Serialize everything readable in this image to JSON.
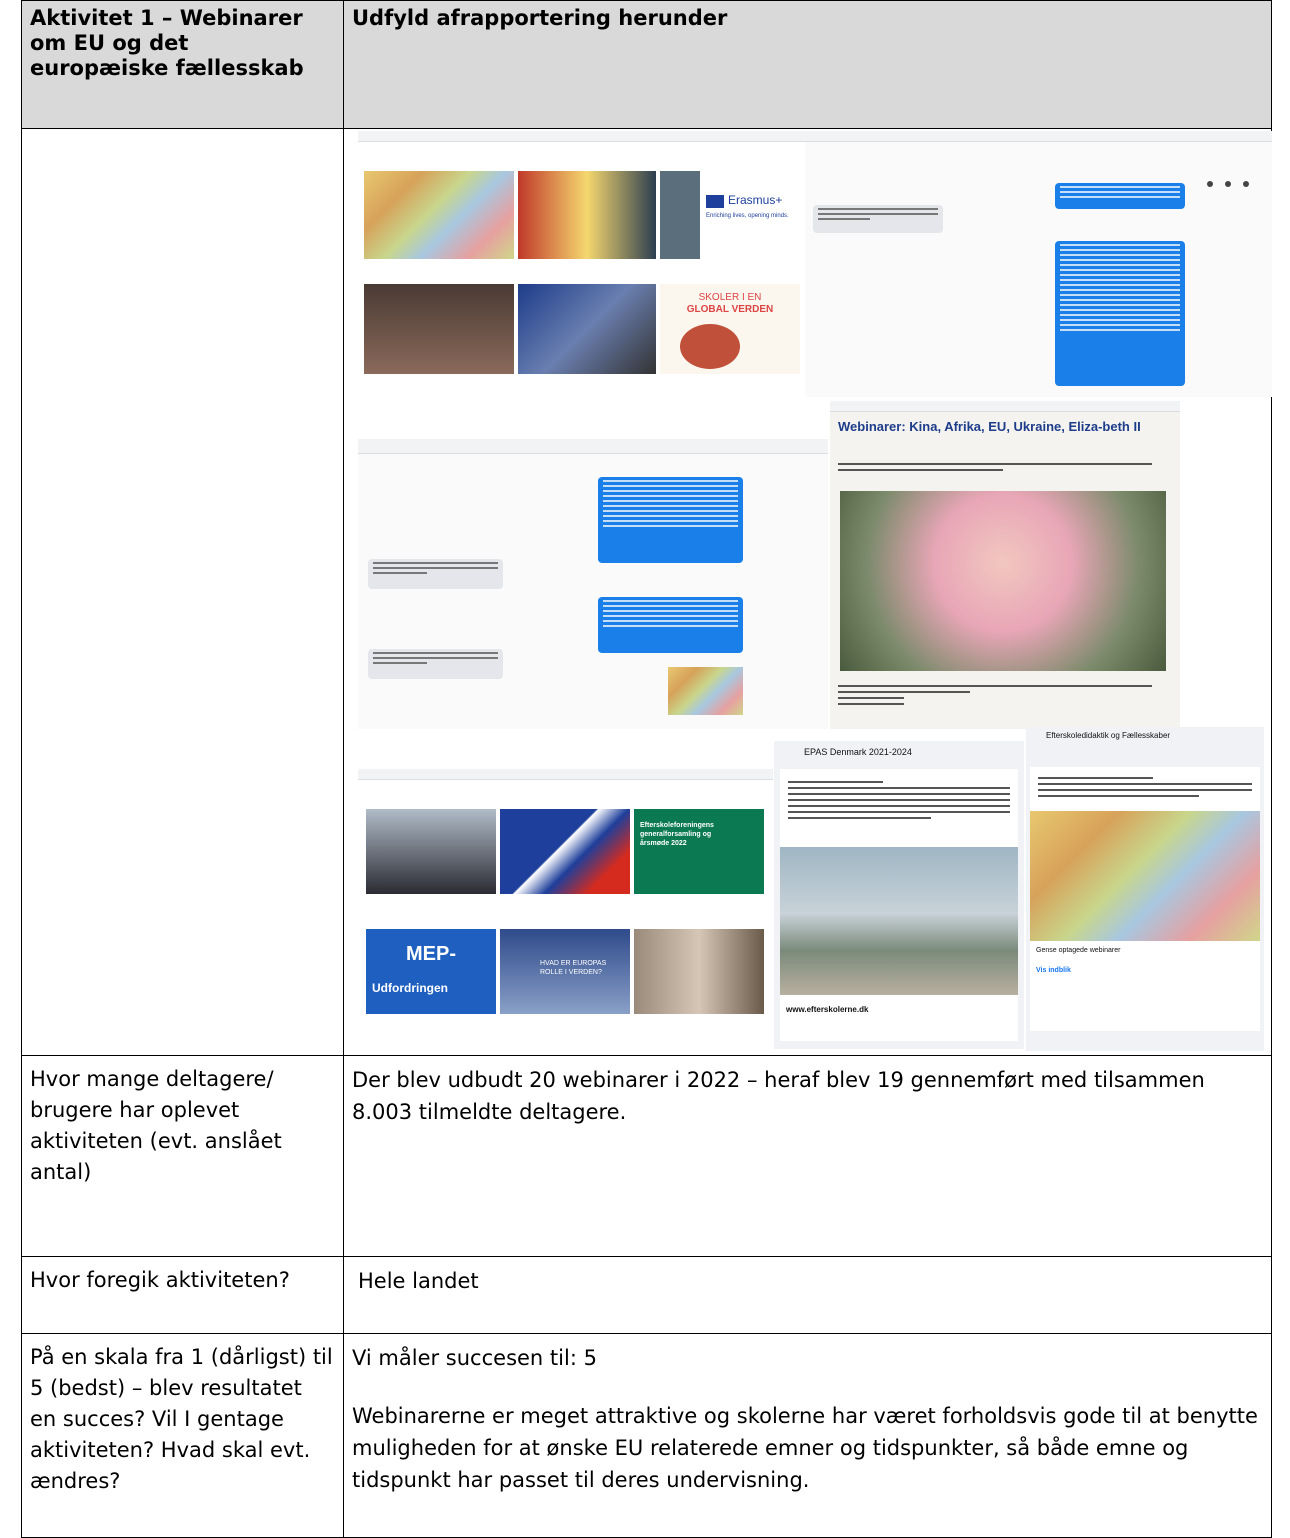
{
  "header": {
    "left": "Aktivitet 1 – Webinarer om EU og det europæiske fællesskab",
    "right": "Udfyld afrapportering herunder"
  },
  "screenshots": {
    "article_title": "Webinarer: Kina, Afrika, EU, Ukraine, Eliza-beth II",
    "tile_erasmus": "Erasmus+",
    "tile_erasmus_sub": "Enriching lives, opening minds.",
    "tile_skoler_line1": "SKOLER I EN",
    "tile_skoler_line2": "GLOBAL VERDEN",
    "tile_efterskole_text": "Efterskoleforeningens generalforsamling og årsmøde 2022",
    "tile_mep_line1": "MEP-",
    "tile_mep_line2": "Udfordringen",
    "tile_europa": "HVAD ER EUROPAS ROLLE I VERDEN?",
    "fb_group_header": "EPAS Denmark 2021-2024",
    "fb_site": "www.efterskolerne.dk",
    "fb2_header": "Efterskoledidaktik og Fællesskaber",
    "fb2_title": "Gense optagede webinarer",
    "fb2_link": "Vis indblik"
  },
  "rows": [
    {
      "question": "Hvor mange deltagere/ brugere har oplevet aktiviteten (evt. anslået antal)",
      "answer": "Der blev udbudt 20 webinarer i 2022 – heraf blev 19 gennemført med tilsammen 8.003 tilmeldte deltagere."
    },
    {
      "question": "Hvor foregik aktiviteten?",
      "answer": "Hele landet"
    },
    {
      "question": "På en skala fra 1 (dårligst) til 5 (bedst) – blev resultatet en succes? Vil I gentage aktiviteten? Hvad skal evt. ændres?",
      "answer_line1": "Vi måler succesen til: 5",
      "answer_line2": "Webinarerne er meget attraktive og skolerne har været forholdsvis gode til at benytte muligheden for at ønske EU relaterede emner og tidspunkter, så både emne og tidspunkt har passet til deres undervisning."
    }
  ],
  "colors": {
    "header_bg": "#d9d9d9",
    "chat_blue": "#1a7fe8",
    "border": "#000000"
  }
}
